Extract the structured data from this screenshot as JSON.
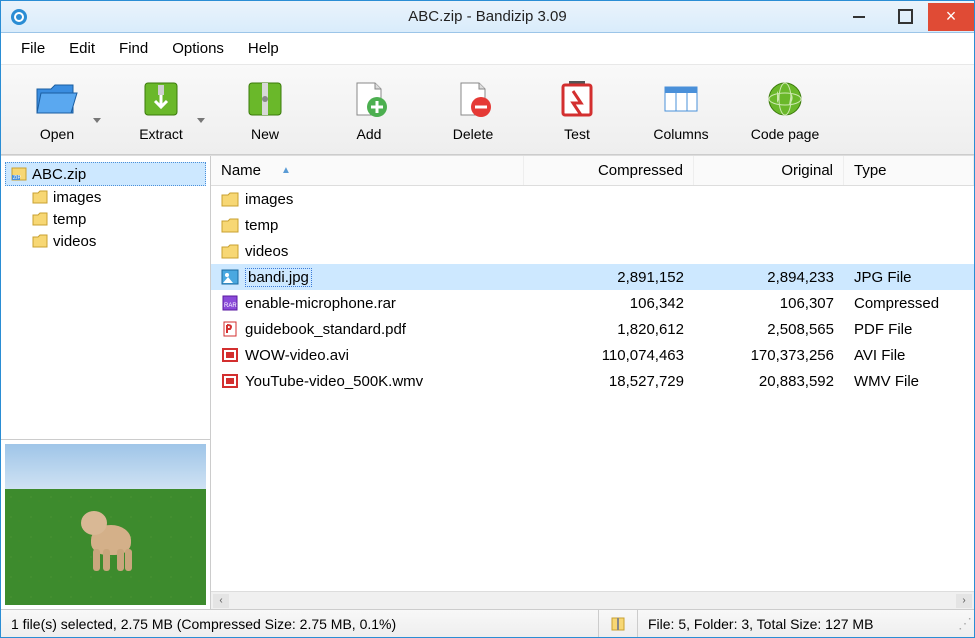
{
  "title": "ABC.zip - Bandizip 3.09",
  "menu": [
    "File",
    "Edit",
    "Find",
    "Options",
    "Help"
  ],
  "toolbar": [
    {
      "id": "open",
      "label": "Open",
      "dropdown": true
    },
    {
      "id": "extract",
      "label": "Extract",
      "dropdown": true
    },
    {
      "id": "new",
      "label": "New",
      "dropdown": false
    },
    {
      "id": "add",
      "label": "Add",
      "dropdown": false
    },
    {
      "id": "delete",
      "label": "Delete",
      "dropdown": false
    },
    {
      "id": "test",
      "label": "Test",
      "dropdown": false
    },
    {
      "id": "columns",
      "label": "Columns",
      "dropdown": false
    },
    {
      "id": "codepage",
      "label": "Code page",
      "dropdown": false
    }
  ],
  "tree": {
    "root": "ABC.zip",
    "children": [
      "images",
      "temp",
      "videos"
    ]
  },
  "columns": {
    "name": "Name",
    "compressed": "Compressed",
    "original": "Original",
    "type": "Type"
  },
  "rows": [
    {
      "icon": "folder",
      "name": "images",
      "compressed": "",
      "original": "",
      "type": ""
    },
    {
      "icon": "folder",
      "name": "temp",
      "compressed": "",
      "original": "",
      "type": ""
    },
    {
      "icon": "folder",
      "name": "videos",
      "compressed": "",
      "original": "",
      "type": ""
    },
    {
      "icon": "jpg",
      "name": "bandi.jpg",
      "compressed": "2,891,152",
      "original": "2,894,233",
      "type": "JPG File",
      "selected": true
    },
    {
      "icon": "rar",
      "name": "enable-microphone.rar",
      "compressed": "106,342",
      "original": "106,307",
      "type": "Compressed"
    },
    {
      "icon": "pdf",
      "name": "guidebook_standard.pdf",
      "compressed": "1,820,612",
      "original": "2,508,565",
      "type": "PDF File"
    },
    {
      "icon": "video",
      "name": "WOW-video.avi",
      "compressed": "110,074,463",
      "original": "170,373,256",
      "type": "AVI File"
    },
    {
      "icon": "video",
      "name": "YouTube-video_500K.wmv",
      "compressed": "18,527,729",
      "original": "20,883,592",
      "type": "WMV File"
    }
  ],
  "status": {
    "left": "1 file(s) selected, 2.75 MB (Compressed Size: 2.75 MB, 0.1%)",
    "right": "File: 5, Folder: 3, Total Size: 127 MB"
  }
}
